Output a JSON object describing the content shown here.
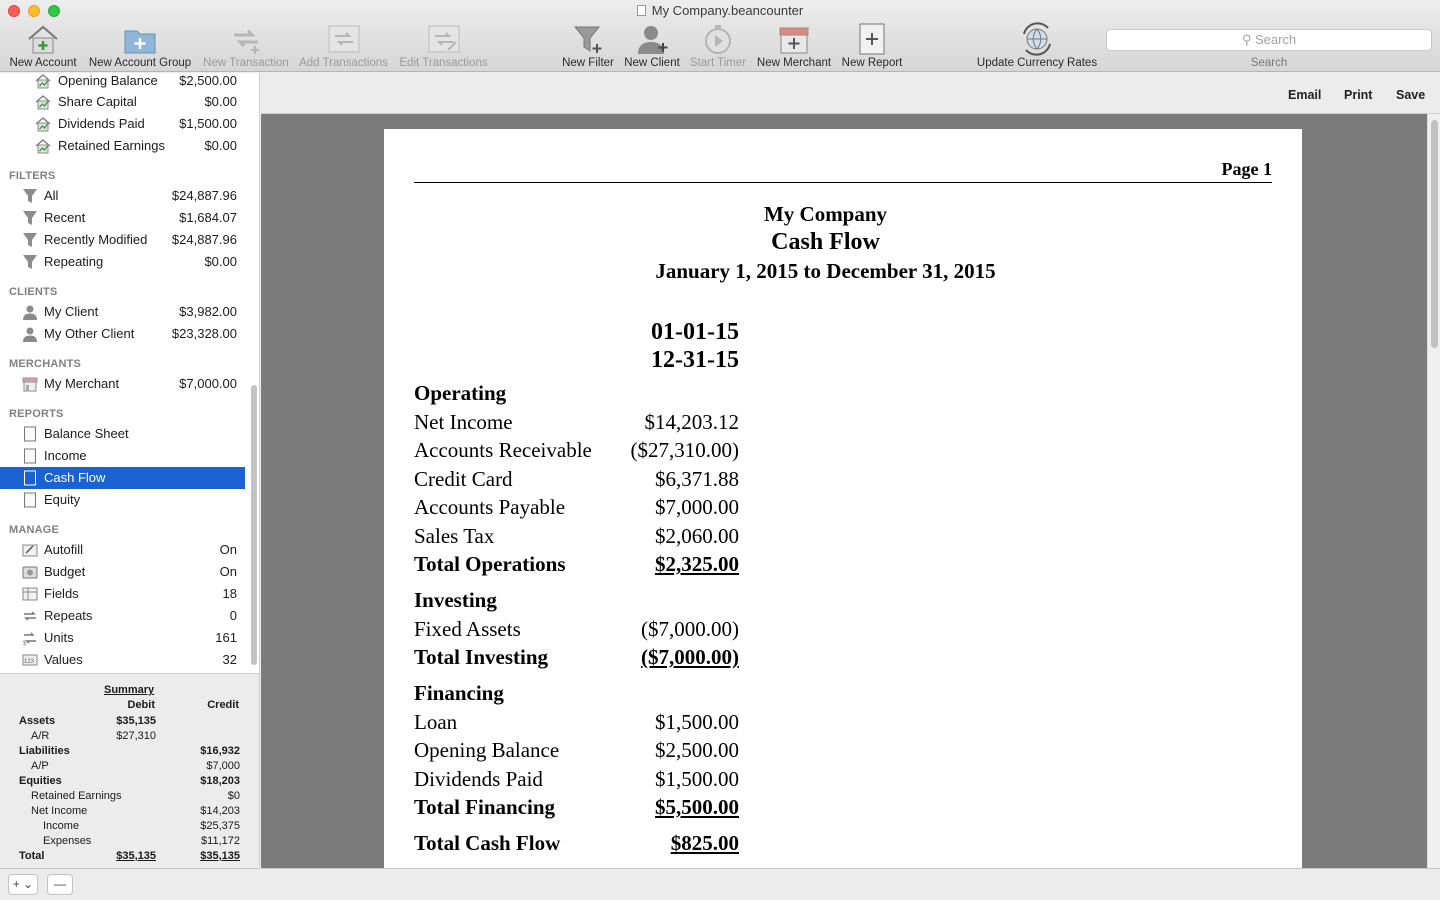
{
  "window": {
    "title": "My Company.beancounter"
  },
  "toolbar": {
    "new_account": "New Account",
    "new_account_group": "New Account Group",
    "new_transaction": "New Transaction",
    "add_transactions": "Add Transactions",
    "edit_transactions": "Edit Transactions",
    "new_filter": "New Filter",
    "new_client": "New Client",
    "start_timer": "Start Timer",
    "new_merchant": "New Merchant",
    "new_report": "New Report",
    "update_currency": "Update Currency Rates",
    "search_placeholder": "Search",
    "search_label": "Search"
  },
  "sidebar": {
    "equity_items": [
      {
        "label": "Opening Balance",
        "amount": "$2,500.00"
      },
      {
        "label": "Share Capital",
        "amount": "$0.00"
      },
      {
        "label": "Dividends Paid",
        "amount": "$1,500.00"
      },
      {
        "label": "Retained Earnings",
        "amount": "$0.00"
      }
    ],
    "filters_header": "FILTERS",
    "filters": [
      {
        "label": "All",
        "amount": "$24,887.96"
      },
      {
        "label": "Recent",
        "amount": "$1,684.07"
      },
      {
        "label": "Recently Modified",
        "amount": "$24,887.96"
      },
      {
        "label": "Repeating",
        "amount": "$0.00"
      }
    ],
    "clients_header": "CLIENTS",
    "clients": [
      {
        "label": "My Client",
        "amount": "$3,982.00"
      },
      {
        "label": "My Other Client",
        "amount": "$23,328.00"
      }
    ],
    "merchants_header": "MERCHANTS",
    "merchants": [
      {
        "label": "My Merchant",
        "amount": "$7,000.00"
      }
    ],
    "reports_header": "REPORTS",
    "reports": [
      {
        "label": "Balance Sheet"
      },
      {
        "label": "Income"
      },
      {
        "label": "Cash Flow"
      },
      {
        "label": "Equity"
      }
    ],
    "manage_header": "MANAGE",
    "manage": [
      {
        "label": "Autofill",
        "value": "On"
      },
      {
        "label": "Budget",
        "value": "On"
      },
      {
        "label": "Fields",
        "value": "18"
      },
      {
        "label": "Repeats",
        "value": "0"
      },
      {
        "label": "Units",
        "value": "161"
      },
      {
        "label": "Values",
        "value": "32"
      }
    ]
  },
  "summary": {
    "title": "Summary",
    "debit": "Debit",
    "credit": "Credit",
    "rows": [
      {
        "label": "Assets",
        "debit": "$35,135",
        "credit": ""
      },
      {
        "label": "A/R",
        "debit": "$27,310",
        "credit": ""
      },
      {
        "label": "Liabilities",
        "debit": "",
        "credit": "$16,932"
      },
      {
        "label": "A/P",
        "debit": "",
        "credit": "$7,000"
      },
      {
        "label": "Equities",
        "debit": "",
        "credit": "$18,203"
      },
      {
        "label": "Retained Earnings",
        "debit": "",
        "credit": "$0"
      },
      {
        "label": "Net Income",
        "debit": "",
        "credit": "$14,203"
      },
      {
        "label": "Income",
        "debit": "",
        "credit": "$25,375"
      },
      {
        "label": "Expenses",
        "debit": "",
        "credit": "$11,172"
      },
      {
        "label": "Total",
        "debit": "$35,135",
        "credit": "$35,135"
      }
    ]
  },
  "bottom": {
    "add": "+ ⌄",
    "remove": "—"
  },
  "report_actions": {
    "email": "Email",
    "print": "Print",
    "save": "Save"
  },
  "report": {
    "page": "Page 1",
    "company": "My Company",
    "title": "Cash Flow",
    "period": "January 1, 2015 to December 31, 2015",
    "col_start": "01-01-15",
    "col_end": "12-31-15",
    "operating_header": "Operating",
    "operating": [
      {
        "label": "Net Income",
        "value": "$14,203.12"
      },
      {
        "label": "Accounts Receivable",
        "value": "($27,310.00)"
      },
      {
        "label": "Credit Card",
        "value": "$6,371.88"
      },
      {
        "label": "Accounts Payable",
        "value": "$7,000.00"
      },
      {
        "label": "Sales Tax",
        "value": "$2,060.00"
      }
    ],
    "total_operations": {
      "label": "Total Operations",
      "value": "$2,325.00"
    },
    "investing_header": "Investing",
    "investing": [
      {
        "label": "Fixed Assets",
        "value": "($7,000.00)"
      }
    ],
    "total_investing": {
      "label": "Total Investing",
      "value": "($7,000.00)"
    },
    "financing_header": "Financing",
    "financing": [
      {
        "label": "Loan",
        "value": "$1,500.00"
      },
      {
        "label": "Opening Balance",
        "value": "$2,500.00"
      },
      {
        "label": "Dividends Paid",
        "value": "$1,500.00"
      }
    ],
    "total_financing": {
      "label": "Total Financing",
      "value": "$5,500.00"
    },
    "total_cash_flow": {
      "label": "Total Cash Flow",
      "value": "$825.00"
    }
  }
}
